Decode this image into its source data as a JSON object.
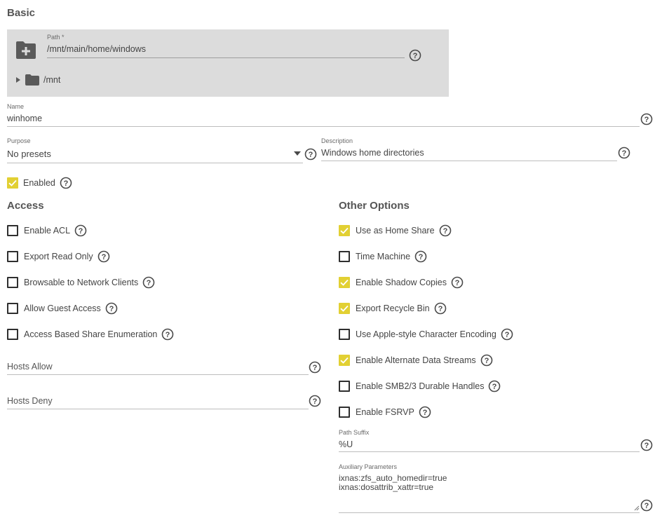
{
  "basic": {
    "title": "Basic",
    "path": {
      "label": "Path *",
      "value": "/mnt/main/home/windows",
      "tree_root": "/mnt"
    },
    "name": {
      "label": "Name",
      "value": "winhome"
    },
    "purpose": {
      "label": "Purpose",
      "value": "No presets"
    },
    "description": {
      "label": "Description",
      "value": "Windows home directories"
    },
    "enabled": {
      "label": "Enabled",
      "checked": true
    }
  },
  "access": {
    "title": "Access",
    "options": [
      {
        "label": "Enable ACL",
        "checked": false
      },
      {
        "label": "Export Read Only",
        "checked": false
      },
      {
        "label": "Browsable to Network Clients",
        "checked": false
      },
      {
        "label": "Allow Guest Access",
        "checked": false
      },
      {
        "label": "Access Based Share Enumeration",
        "checked": false
      }
    ],
    "hosts_allow": {
      "placeholder": "Hosts Allow"
    },
    "hosts_deny": {
      "placeholder": "Hosts Deny"
    }
  },
  "other": {
    "title": "Other Options",
    "options": [
      {
        "label": "Use as Home Share",
        "checked": true
      },
      {
        "label": "Time Machine",
        "checked": false
      },
      {
        "label": "Enable Shadow Copies",
        "checked": true
      },
      {
        "label": "Export Recycle Bin",
        "checked": true
      },
      {
        "label": "Use Apple-style Character Encoding",
        "checked": false
      },
      {
        "label": "Enable Alternate Data Streams",
        "checked": true
      },
      {
        "label": "Enable SMB2/3 Durable Handles",
        "checked": false
      },
      {
        "label": "Enable FSRVP",
        "checked": false
      }
    ],
    "path_suffix": {
      "label": "Path Suffix",
      "value": "%U"
    },
    "aux_params": {
      "label": "Auxiliary Parameters",
      "value": "ixnas:zfs_auto_homedir=true\nixnas:dosattrib_xattr=true"
    }
  },
  "colors": {
    "accent": "#e2d033",
    "text": "#444444",
    "panel": "#dcdcdc"
  },
  "icons": [
    "folder-plus-icon",
    "folder-icon",
    "expand-arrow-icon",
    "help-icon",
    "dropdown-arrow-icon",
    "checkmark-icon",
    "resize-handle-icon"
  ]
}
